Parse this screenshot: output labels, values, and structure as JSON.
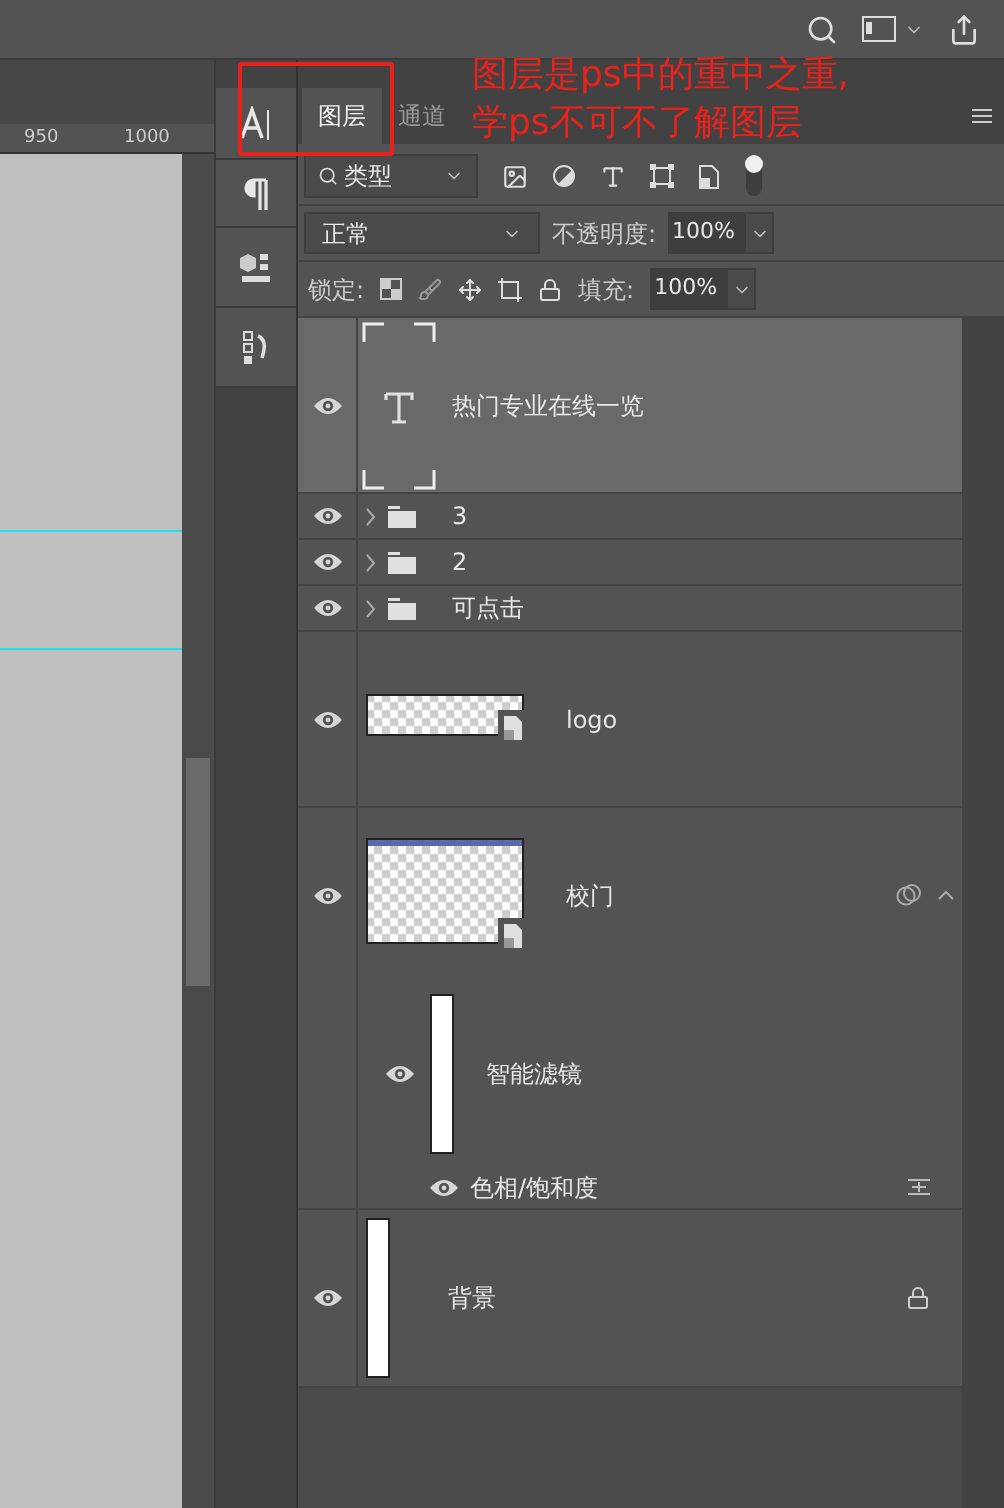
{
  "ruler": {
    "labels": [
      "950",
      "1000"
    ]
  },
  "panel": {
    "tabs": [
      {
        "label": "图层",
        "selected": true
      },
      {
        "label": "通道",
        "selected": false
      }
    ],
    "filter": {
      "value": "类型"
    },
    "blend_mode": {
      "value": "正常"
    },
    "opacity": {
      "label": "不透明度:",
      "value": "100%"
    },
    "lock": {
      "label": "锁定:"
    },
    "fill": {
      "label": "填充:",
      "value": "100%"
    },
    "layers": [
      {
        "kind": "text",
        "name": "热门专业在线一览",
        "visible": true,
        "selected": true
      },
      {
        "kind": "group",
        "name": "3",
        "visible": true,
        "selected": false
      },
      {
        "kind": "group",
        "name": "2",
        "visible": true,
        "selected": false
      },
      {
        "kind": "group",
        "name": "可点击",
        "visible": true,
        "selected": false
      },
      {
        "kind": "smart",
        "name": "logo",
        "visible": true,
        "selected": false
      },
      {
        "kind": "smart_filtered",
        "name": "校门",
        "visible": true,
        "selected": false,
        "filter_mask": {
          "name": "智能滤镜",
          "visible": true
        },
        "filters": [
          {
            "name": "色相/饱和度",
            "visible": true
          }
        ]
      },
      {
        "kind": "background",
        "name": "背景",
        "visible": true,
        "selected": false
      }
    ]
  },
  "annotation": {
    "lines": [
      "图层是ps中的重中之重,",
      "学ps不可不了解图层"
    ]
  }
}
